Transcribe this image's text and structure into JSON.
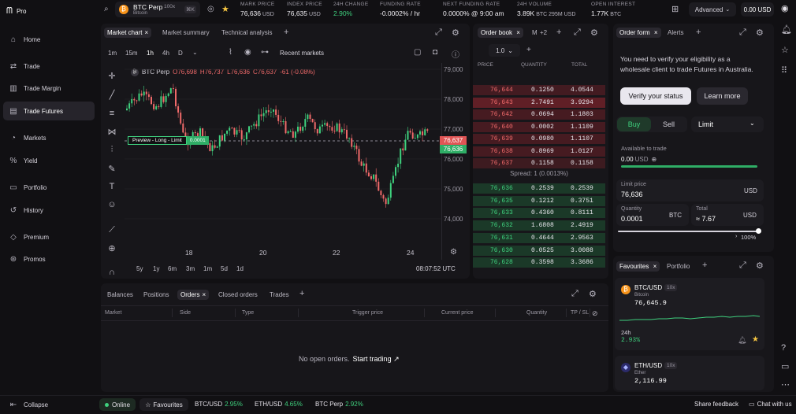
{
  "app": {
    "logo": "Pro"
  },
  "sidebar": {
    "items": [
      {
        "label": "Home",
        "icon": "home-icon",
        "glyph": "⌂"
      },
      {
        "label": "Trade",
        "icon": "trade-icon",
        "glyph": "⇄"
      },
      {
        "label": "Trade Margin",
        "icon": "margin-icon",
        "glyph": "▥"
      },
      {
        "label": "Trade Futures",
        "icon": "futures-icon",
        "glyph": "▤"
      },
      {
        "label": "Markets",
        "icon": "markets-icon",
        "glyph": "◔"
      },
      {
        "label": "Yield",
        "icon": "yield-icon",
        "glyph": "%"
      },
      {
        "label": "Portfolio",
        "icon": "portfolio-icon",
        "glyph": "▭"
      },
      {
        "label": "History",
        "icon": "history-icon",
        "glyph": "↺"
      },
      {
        "label": "Premium",
        "icon": "premium-icon",
        "glyph": "◇"
      },
      {
        "label": "Promos",
        "icon": "promos-icon",
        "glyph": "⊛"
      }
    ],
    "collapse": "Collapse"
  },
  "header": {
    "symbol": "BTC Perp",
    "leverage": "100x",
    "subtitle": "Bitcoin",
    "shortcut": "⌘K",
    "stats": [
      {
        "key": "MARK PRICE",
        "val": "76,636",
        "unit": "USD"
      },
      {
        "key": "INDEX PRICE",
        "val": "76,635",
        "unit": "USD"
      },
      {
        "key": "24H CHANGE",
        "val": "2.90%",
        "unit": ""
      },
      {
        "key": "FUNDING RATE",
        "val": "-0.0002% / hr",
        "unit": ""
      },
      {
        "key": "NEXT FUNDING RATE",
        "val": "0.0000% @ 9:00 am",
        "unit": ""
      },
      {
        "key": "24H VOLUME",
        "val": "3.89K",
        "unit": "BTC  295M USD"
      },
      {
        "key": "OPEN INTEREST",
        "val": "1.77K",
        "unit": "BTC"
      }
    ],
    "mode": "Advanced",
    "balance": "0.00 USD"
  },
  "chart": {
    "tabs": [
      "Market chart",
      "Market summary",
      "Technical analysis"
    ],
    "intervals": [
      "1m",
      "15m",
      "1h",
      "4h",
      "D"
    ],
    "recent": "Recent markets",
    "ohlc": {
      "name": "BTC Perp",
      "o": "O76,698",
      "h": "H76,737",
      "l": "L76,636",
      "c": "C76,637",
      "chg": "-61 (-0.08%)"
    },
    "preview_label": "Preview - Long - Limit",
    "preview_val": "0.0001",
    "price_ticks": [
      "79,000",
      "78,000",
      "77,000",
      "76,000",
      "75,000",
      "74,000"
    ],
    "price_tag_red": "76,637",
    "price_tag_green": "76,636",
    "date_ticks": [
      "18",
      "20",
      "22",
      "24"
    ],
    "ranges": [
      "5y",
      "1y",
      "6m",
      "3m",
      "1m",
      "5d",
      "1d"
    ],
    "time": "08:07:52 UTC"
  },
  "orderbook": {
    "tab": "Order book",
    "tab2": "M",
    "more": "+2",
    "tick": "1.0",
    "headers": [
      "PRICE",
      "QUANTITY",
      "TOTAL"
    ],
    "asks": [
      [
        "76,644",
        "0.1250",
        "4.0544"
      ],
      [
        "76,643",
        "2.7491",
        "3.9294"
      ],
      [
        "76,642",
        "0.0694",
        "1.1803"
      ],
      [
        "76,640",
        "0.0002",
        "1.1109"
      ],
      [
        "76,639",
        "0.0980",
        "1.1107"
      ],
      [
        "76,638",
        "0.8969",
        "1.0127"
      ],
      [
        "76,637",
        "0.1158",
        "0.1158"
      ]
    ],
    "spread": "Spread: 1 (0.0013%)",
    "bids": [
      [
        "76,636",
        "0.2539",
        "0.2539"
      ],
      [
        "76,635",
        "0.1212",
        "0.3751"
      ],
      [
        "76,633",
        "0.4360",
        "0.8111"
      ],
      [
        "76,632",
        "1.6808",
        "2.4919"
      ],
      [
        "76,631",
        "0.4644",
        "2.9563"
      ],
      [
        "76,630",
        "0.0525",
        "3.0088"
      ],
      [
        "76,628",
        "0.3598",
        "3.3686"
      ]
    ]
  },
  "orderform": {
    "tabs": [
      "Order form",
      "Alerts"
    ],
    "notice": "You need to verify your eligibility as a wholesale client to trade Futures in Australia.",
    "verify": "Verify your status",
    "learn": "Learn more",
    "buy": "Buy",
    "sell": "Sell",
    "type": "Limit",
    "avail_label": "Available to trade",
    "avail_val": "0.00",
    "avail_unit": "USD",
    "price_label": "Limit price",
    "price_val": "76,636",
    "price_unit": "USD",
    "qty_label": "Quantity",
    "qty_val": "0.0001",
    "qty_unit": "BTC",
    "total_label": "Total",
    "total_val": "≈  7.67",
    "total_unit": "USD",
    "slider_pct": "100%"
  },
  "watch": {
    "tabs": [
      "Favourites",
      "Portfolio"
    ],
    "items": [
      {
        "pair": "BTC/USD",
        "lev": "10x",
        "name": "Bitcoin",
        "price": "76,645.9",
        "period": "24h",
        "chg": "2.93%"
      },
      {
        "pair": "ETH/USD",
        "lev": "10x",
        "name": "Ether",
        "price": "2,116.99"
      }
    ]
  },
  "bottom": {
    "tabs": [
      "Balances",
      "Positions",
      "Orders",
      "Closed orders",
      "Trades"
    ],
    "cols": [
      "Market",
      "Side",
      "Type",
      "Trigger price",
      "Current price",
      "Quantity",
      "TP / SL"
    ],
    "empty": "No open orders.",
    "empty_link": "Start trading ↗"
  },
  "footer": {
    "status": "Online",
    "fav": "Favourites",
    "tickers": [
      {
        "sym": "BTC/USD",
        "chg": "2.95%"
      },
      {
        "sym": "ETH/USD",
        "chg": "4.65%"
      },
      {
        "sym": "BTC Perp",
        "chg": "2.92%"
      }
    ],
    "feedback": "Share feedback",
    "chat": "Chat with us"
  },
  "colors": {
    "green": "#3fd17e",
    "red": "#f06a6a",
    "bg": "#111013",
    "panel": "#17161a"
  }
}
